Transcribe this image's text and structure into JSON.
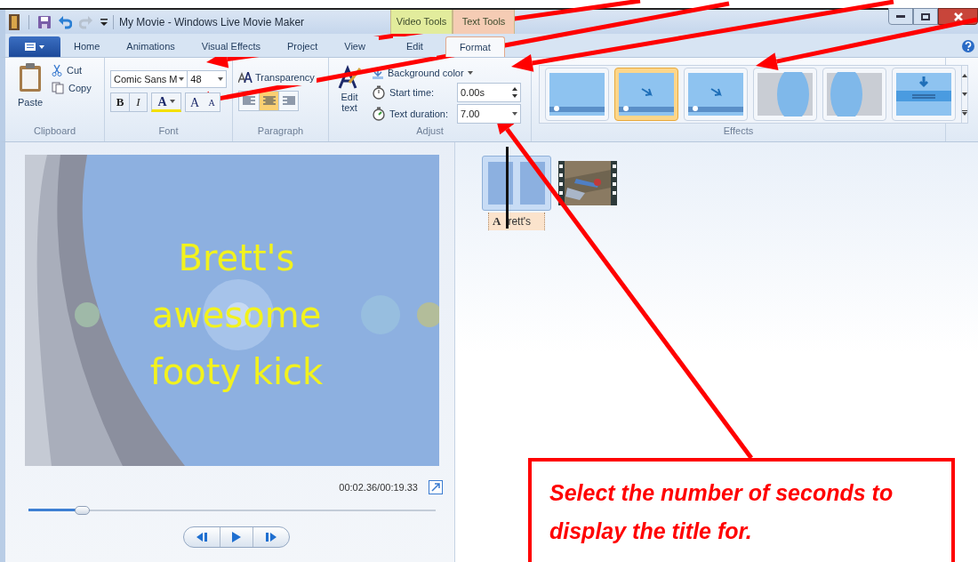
{
  "title_bar": {
    "title": "My Movie - Windows Live Movie Maker",
    "contextual_tabs": [
      {
        "label": "Video Tools",
        "color": "#e2ec9c"
      },
      {
        "label": "Text Tools",
        "color": "#f5ccb4"
      }
    ]
  },
  "tabs": [
    {
      "label": "Home",
      "selected": false
    },
    {
      "label": "Animations",
      "selected": false
    },
    {
      "label": "Visual Effects",
      "selected": false
    },
    {
      "label": "Project",
      "selected": false
    },
    {
      "label": "View",
      "selected": false
    },
    {
      "label": "Edit",
      "selected": false
    },
    {
      "label": "Format",
      "selected": true
    }
  ],
  "clipboard": {
    "paste": "Paste",
    "cut": "Cut",
    "copy": "Copy",
    "label": "Clipboard"
  },
  "font": {
    "family": "Comic Sans M",
    "size": "48",
    "bold": "B",
    "italic": "I",
    "color_button": "A",
    "grow": "A",
    "shrink": "A",
    "label": "Font"
  },
  "paragraph": {
    "transparency": "Transparency",
    "align": [
      {
        "kind": "left",
        "selected": false
      },
      {
        "kind": "center",
        "selected": true
      },
      {
        "kind": "right",
        "selected": false
      }
    ],
    "label": "Paragraph"
  },
  "adjust": {
    "edit_text": "Edit text",
    "background_color": "Background color",
    "start_time_label": "Start time:",
    "start_time": "0.00s",
    "duration_label": "Text duration:",
    "duration": "7.00",
    "label": "Adjust"
  },
  "effects": {
    "items": [
      {
        "kind": "sparkle",
        "selected": false
      },
      {
        "kind": "sparkle-arrow",
        "selected": true
      },
      {
        "kind": "sparkle-arrow",
        "selected": false
      },
      {
        "kind": "swing-left",
        "selected": false
      },
      {
        "kind": "swing-right",
        "selected": false
      },
      {
        "kind": "drop",
        "selected": false
      }
    ],
    "label": "Effects"
  },
  "preview": {
    "title_lines": [
      "Brett's",
      "awesome",
      "footy kick"
    ],
    "time": "00:02.36/00:19.33",
    "seek": {
      "level": 0.13
    }
  },
  "storyboard": {
    "clips": [
      {
        "kind": "title",
        "badge": "A",
        "caption": "rett's",
        "selected": true
      },
      {
        "kind": "video",
        "selected": false
      }
    ]
  },
  "callout": {
    "text": "Select the number of seconds to display the title for."
  }
}
